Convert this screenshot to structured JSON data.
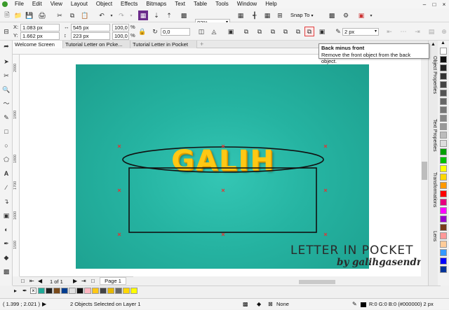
{
  "menu": [
    "File",
    "Edit",
    "View",
    "Layout",
    "Object",
    "Effects",
    "Bitmaps",
    "Text",
    "Table",
    "Tools",
    "Window",
    "Help"
  ],
  "standard_toolbar": {
    "zoom": "82%",
    "snap_to": "Snap To"
  },
  "property_bar": {
    "x_label": "X:",
    "x_value": "1.083 px",
    "y_label": "Y:",
    "y_value": "1.662 px",
    "width_value": "545 px",
    "height_value": "223 px",
    "scale_w": "100,0",
    "scale_h": "100,0",
    "pct": "%",
    "rotation": "0,0",
    "outline_width": "2 px"
  },
  "tooltip": {
    "title": "Back minus front",
    "description": "Remove the front object from the back object."
  },
  "tabs": [
    "Welcome Screen",
    "Tutorial Letter on Pcke...",
    "Tutorial Letter in Pocket"
  ],
  "ruler_left": [
    "2000",
    "1900",
    "1800",
    "1700",
    "1600",
    "1500"
  ],
  "canvas": {
    "main_text": "GALIH",
    "watermark_title": "LETTER IN POCKET",
    "watermark_byline": "by galihgasendra"
  },
  "docker_tabs": [
    "Object Properties",
    "Text Properties",
    "Transformations",
    "Lens"
  ],
  "palette_colors": [
    "#ffffff",
    "#111111",
    "#222222",
    "#333333",
    "#444444",
    "#555555",
    "#666666",
    "#777777",
    "#888888",
    "#999999",
    "#bbbbbb",
    "#dddddd",
    "#00a000",
    "#00c000",
    "#ffff00",
    "#ffd800",
    "#ff9900",
    "#ff0000",
    "#e6007e",
    "#ff00ff",
    "#9900cc",
    "#7a3b1a",
    "#ff9999",
    "#ffcc99",
    "#3399ff",
    "#0000ff",
    "#003399"
  ],
  "document_palette": [
    "#1faa98",
    "#222222",
    "#7a4a1a",
    "#003c8f",
    "#e0e0e0",
    "#111111",
    "#ffb6c1",
    "#ffc814",
    "#444444",
    "#e6b800",
    "#666666",
    "#ffd700",
    "#ffff00"
  ],
  "page_nav": {
    "counter": "1 of 1",
    "page_tab": "Page 1"
  },
  "status": {
    "coords": "( 1.399 ; 2.021 )",
    "selection": "2 Objects Selected on Layer 1",
    "fill": "None",
    "outline": "R:0 G:0 B:0 (#000000)  2 px"
  }
}
